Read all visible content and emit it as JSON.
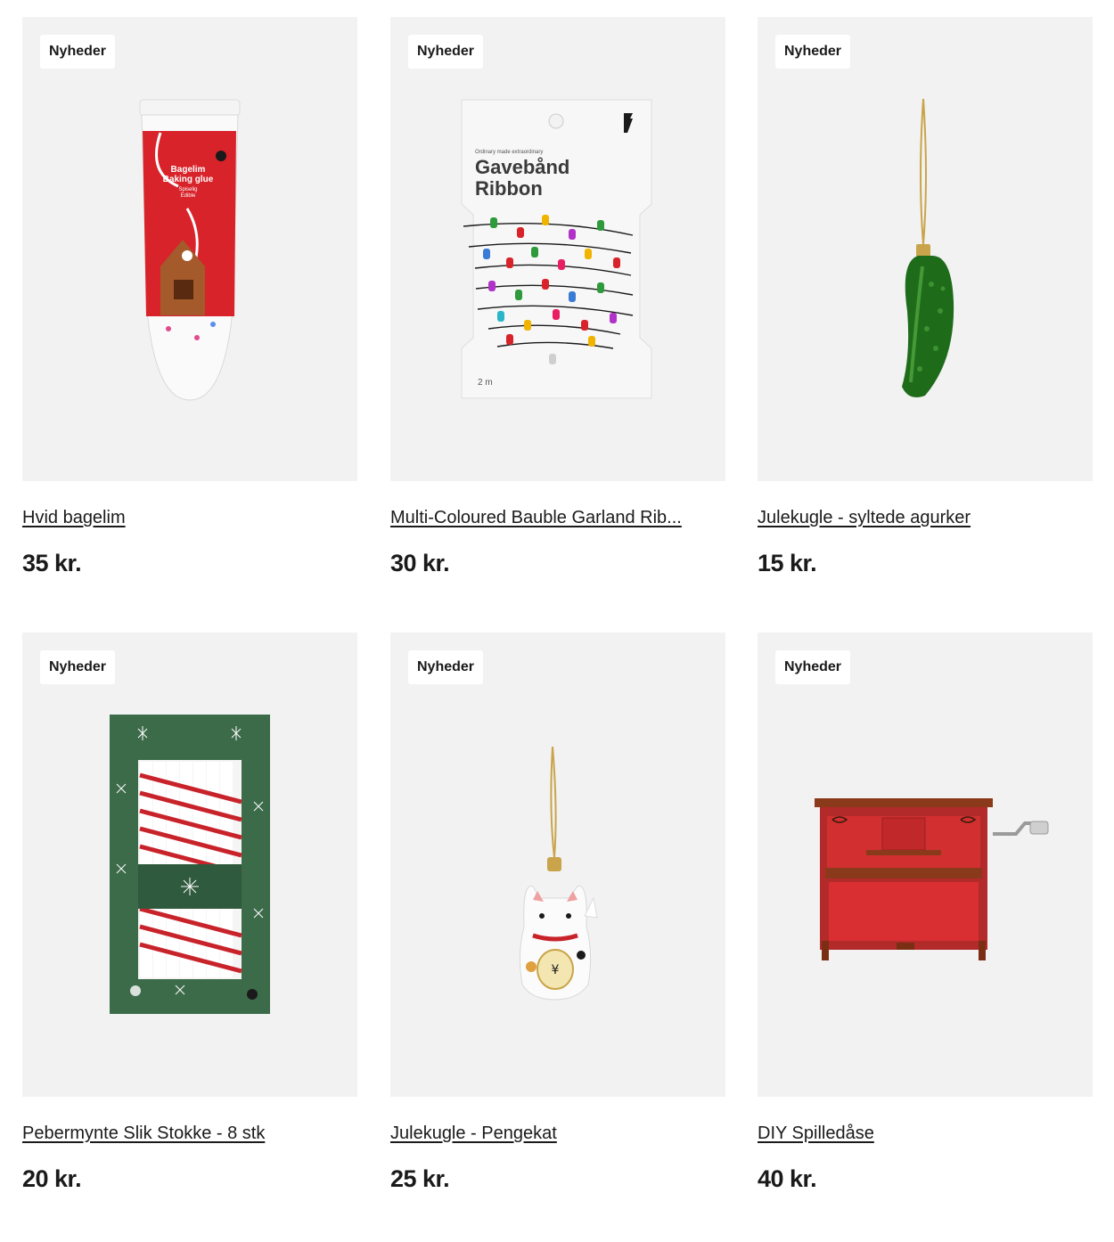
{
  "products": [
    {
      "badge": "Nyheder",
      "title": "Hvid bagelim",
      "price": "35 kr.",
      "image_icon": "baking-glue-tube-image",
      "package_text": {
        "line1": "Bagelim",
        "line2": "Baking glue",
        "line3": "Spiselig",
        "line4": "Edible"
      }
    },
    {
      "badge": "Nyheder",
      "title": "Multi-Coloured Bauble Garland Rib...",
      "price": "30 kr.",
      "image_icon": "garland-ribbon-image",
      "package_text": {
        "tagline": "Ordinary made extraordinary",
        "line1": "Gavebånd",
        "line2": "Ribbon",
        "length": "2 m"
      }
    },
    {
      "badge": "Nyheder",
      "title": "Julekugle - syltede agurker",
      "price": "15 kr.",
      "image_icon": "pickle-ornament-image"
    },
    {
      "badge": "Nyheder",
      "title": "Pebermynte Slik Stokke - 8 stk",
      "price": "20 kr.",
      "image_icon": "candy-canes-box-image"
    },
    {
      "badge": "Nyheder",
      "title": "Julekugle - Pengekat",
      "price": "25 kr.",
      "image_icon": "lucky-cat-ornament-image"
    },
    {
      "badge": "Nyheder",
      "title": "DIY Spilledåse",
      "price": "40 kr.",
      "image_icon": "music-box-piano-image"
    }
  ]
}
